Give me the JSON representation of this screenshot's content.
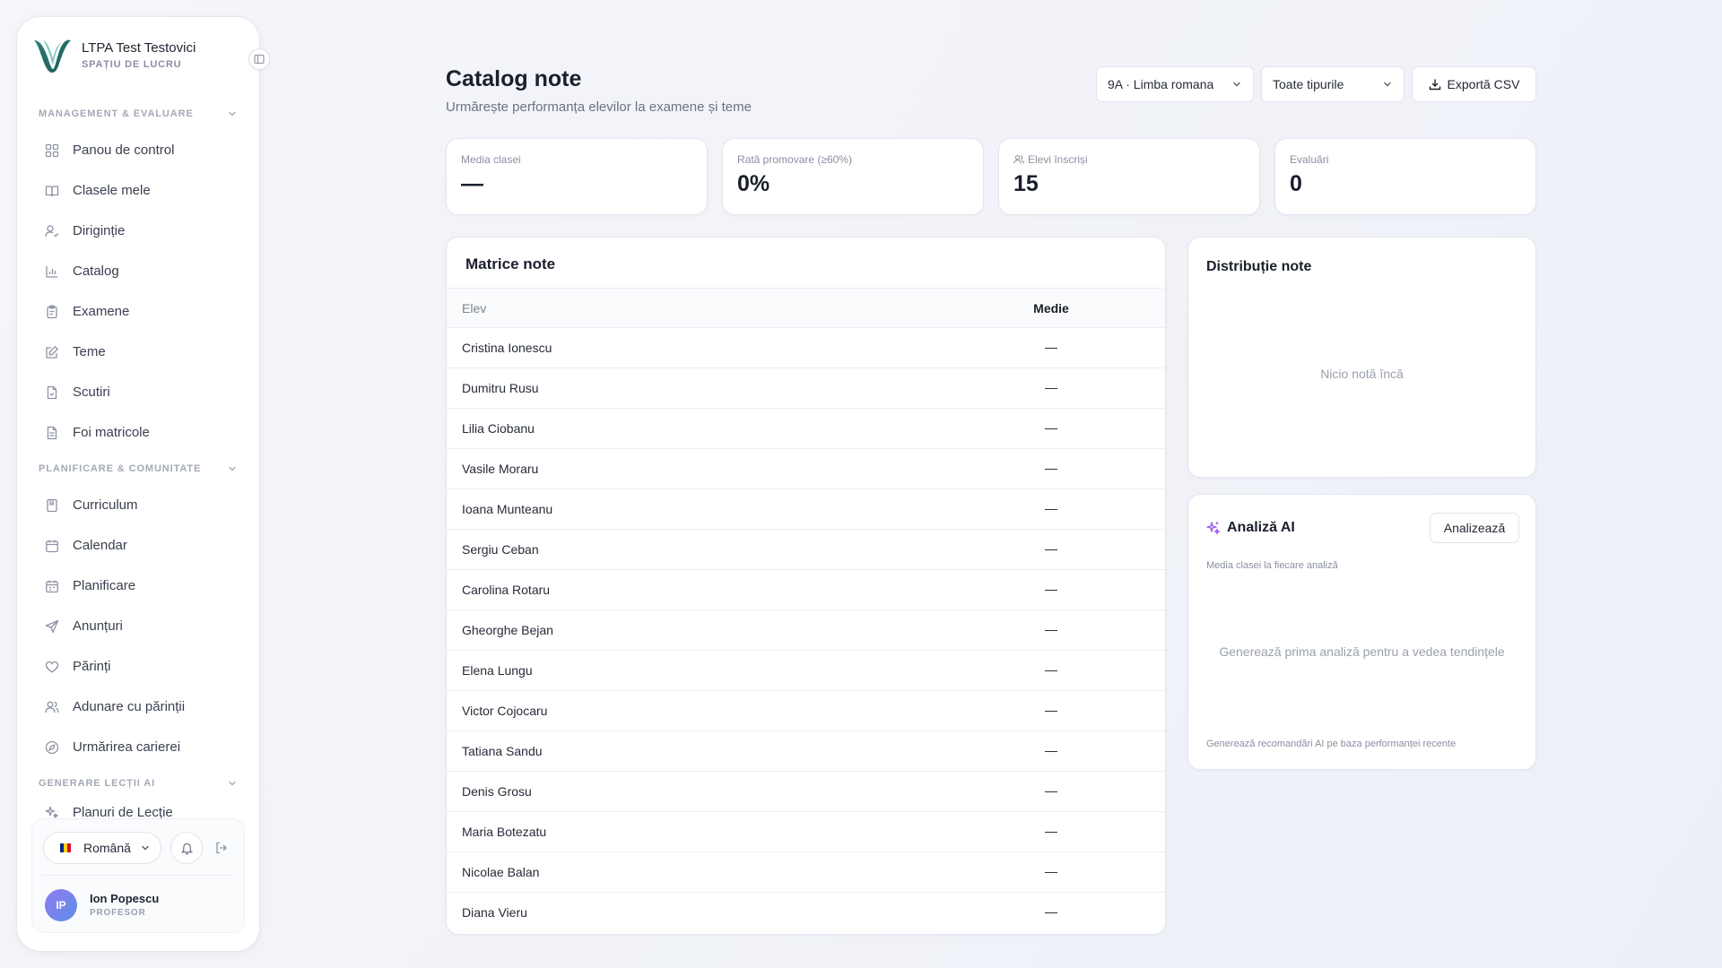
{
  "brand": {
    "name": "LTPA Test Testovici",
    "subtitle": "SPAȚIU DE LUCRU",
    "logo_icon": "v-logo-icon"
  },
  "sidebar": {
    "sections": [
      {
        "label": "MANAGEMENT & EVALUARE",
        "items": [
          {
            "label": "Panou de control",
            "icon": "grid-icon"
          },
          {
            "label": "Clasele mele",
            "icon": "book-open-icon"
          },
          {
            "label": "Diriginție",
            "icon": "user-check-icon"
          },
          {
            "label": "Catalog",
            "icon": "bar-chart-icon"
          },
          {
            "label": "Examene",
            "icon": "clipboard-icon"
          },
          {
            "label": "Teme",
            "icon": "edit-icon"
          },
          {
            "label": "Scutiri",
            "icon": "file-check-icon"
          },
          {
            "label": "Foi matricole",
            "icon": "file-text-icon"
          }
        ]
      },
      {
        "label": "PLANIFICARE & COMUNITATE",
        "items": [
          {
            "label": "Curriculum",
            "icon": "book-icon"
          },
          {
            "label": "Calendar",
            "icon": "calendar-icon"
          },
          {
            "label": "Planificare",
            "icon": "calendar-check-icon"
          },
          {
            "label": "Anunțuri",
            "icon": "send-icon"
          },
          {
            "label": "Părinți",
            "icon": "heart-icon"
          },
          {
            "label": "Adunare cu părinții",
            "icon": "users-icon"
          },
          {
            "label": "Urmărirea carierei",
            "icon": "compass-icon"
          }
        ]
      },
      {
        "label": "GENERARE LECȚII AI",
        "items": [
          {
            "label": "Planuri de Lecție",
            "icon": "sparkles-icon"
          }
        ]
      }
    ],
    "footer": {
      "language": "Română",
      "flag_colors": [
        "#002B7F",
        "#FCD116",
        "#CE1126"
      ],
      "user_initials": "IP",
      "user_name": "Ion Popescu",
      "user_role": "PROFESOR"
    }
  },
  "header": {
    "title": "Catalog note",
    "subtitle": "Urmărește performanța elevilor la examene și teme",
    "class_select": "9A · Limba romana",
    "type_select": "Toate tipurile",
    "export_label": "Exportă CSV"
  },
  "stats": [
    {
      "label": "Media clasei",
      "value": "—"
    },
    {
      "label": "Rată promovare (≥60%)",
      "value": "0%"
    },
    {
      "label": "Elevi înscriși",
      "value": "15",
      "icon": "users-icon"
    },
    {
      "label": "Evaluări",
      "value": "0"
    }
  ],
  "matrix": {
    "title": "Matrice note",
    "columns": [
      "Elev",
      "Medie"
    ],
    "rows": [
      {
        "name": "Cristina Ionescu",
        "avg": "—"
      },
      {
        "name": "Dumitru Rusu",
        "avg": "—"
      },
      {
        "name": "Lilia Ciobanu",
        "avg": "—"
      },
      {
        "name": "Vasile Moraru",
        "avg": "—"
      },
      {
        "name": "Ioana Munteanu",
        "avg": "—"
      },
      {
        "name": "Sergiu Ceban",
        "avg": "—"
      },
      {
        "name": "Carolina Rotaru",
        "avg": "—"
      },
      {
        "name": "Gheorghe Bejan",
        "avg": "—"
      },
      {
        "name": "Elena Lungu",
        "avg": "—"
      },
      {
        "name": "Victor Cojocaru",
        "avg": "—"
      },
      {
        "name": "Tatiana Sandu",
        "avg": "—"
      },
      {
        "name": "Denis Grosu",
        "avg": "—"
      },
      {
        "name": "Maria Botezatu",
        "avg": "—"
      },
      {
        "name": "Nicolae Balan",
        "avg": "—"
      },
      {
        "name": "Diana Vieru",
        "avg": "—"
      }
    ]
  },
  "distribution": {
    "title": "Distribuție note",
    "empty": "Nicio notă încă"
  },
  "ai": {
    "title": "Analiză AI",
    "button": "Analizează",
    "subtitle": "Media clasei la fiecare analiză",
    "empty": "Generează prima analiză pentru a vedea tendințele",
    "footer": "Generează recomandări AI pe baza performanței recente",
    "accent": "#9b5cf6"
  }
}
